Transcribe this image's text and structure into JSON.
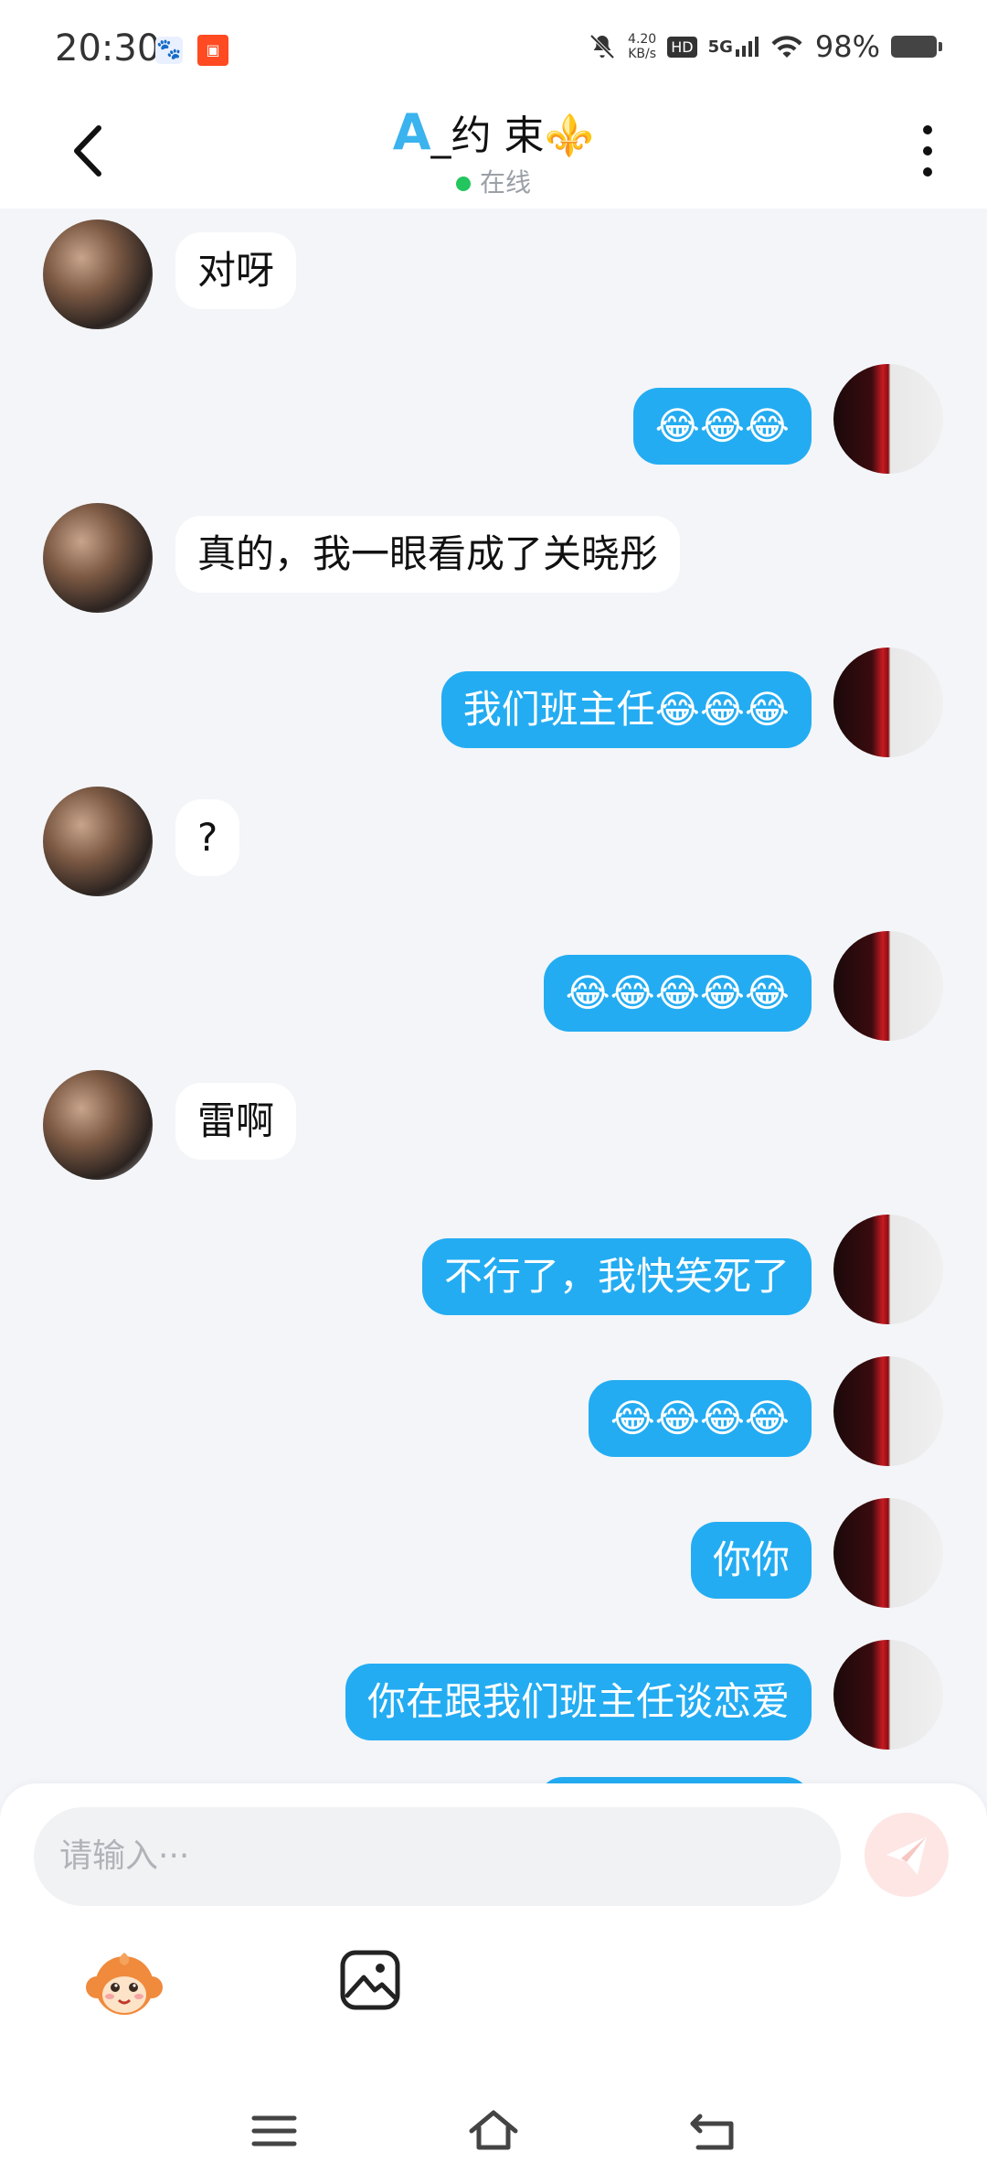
{
  "status_bar": {
    "time": "20:30",
    "network_speed_value": "4.20",
    "network_speed_unit": "KB/s",
    "hd": "HD",
    "network_type": "5G",
    "battery": "98%"
  },
  "header": {
    "title_a": "A",
    "title_rest": "_约 束",
    "title_symbol": "⚜️",
    "status": "在线"
  },
  "messages": [
    {
      "side": "left",
      "text": "对呀"
    },
    {
      "side": "right",
      "text": "😂😂😂"
    },
    {
      "side": "left",
      "text": "真的，我一眼看成了关晓彤"
    },
    {
      "side": "right",
      "text": "我们班主任😂😂😂"
    },
    {
      "side": "left",
      "text": "?"
    },
    {
      "side": "right",
      "text": "😂😂😂😂😂"
    },
    {
      "side": "left",
      "text": "雷啊"
    },
    {
      "side": "right",
      "text": "不行了，我快笑死了"
    },
    {
      "side": "right",
      "text": "😂😂😂😂"
    },
    {
      "side": "right",
      "text": "你你"
    },
    {
      "side": "right",
      "text": "你在跟我们班主任谈恋爱"
    }
  ],
  "input": {
    "placeholder": "请输入···"
  },
  "icons": {
    "back": "chevron-left-icon",
    "more": "more-vertical-icon",
    "send": "paper-plane-icon",
    "sticker": "monkey-sticker-icon",
    "image": "image-icon",
    "nav_menu": "menu-icon",
    "nav_home": "home-icon",
    "nav_back": "back-icon"
  },
  "colors": {
    "outgoing_bubble": "#23acf2",
    "incoming_bubble": "#ffffff",
    "background": "#f3f5f8",
    "online_dot": "#22c55e",
    "send_button": "#fde6e4"
  }
}
